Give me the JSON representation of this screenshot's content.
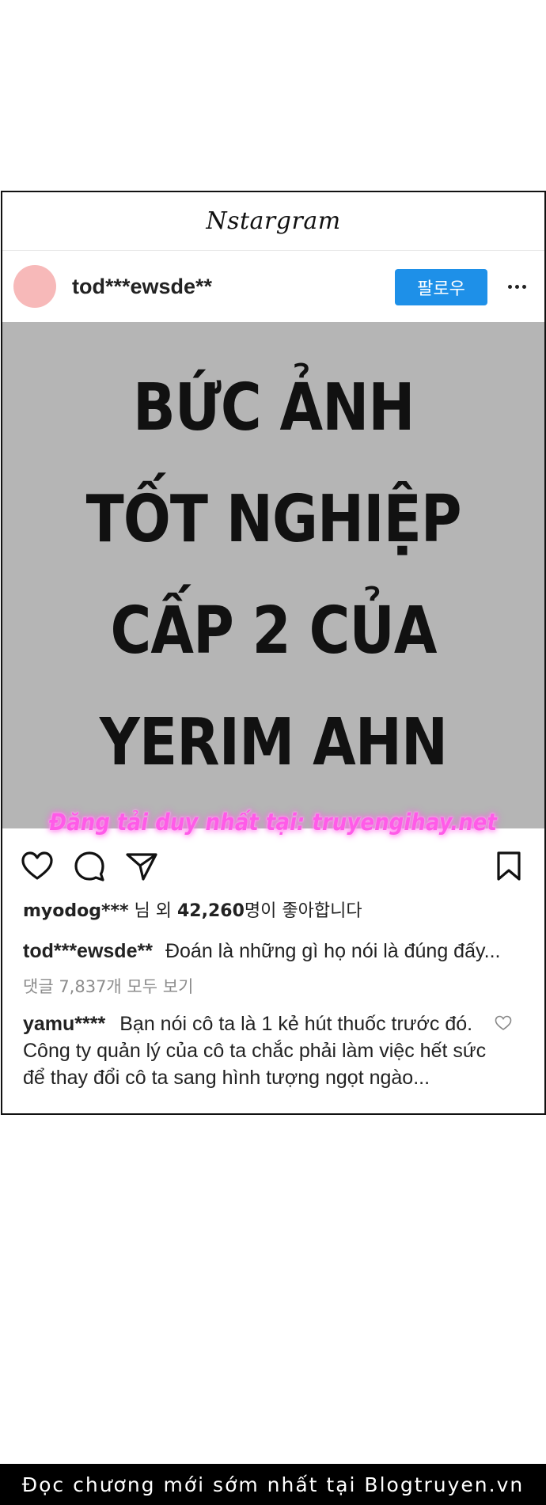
{
  "app": {
    "title": "Nstargram"
  },
  "post": {
    "username": "tod***ewsde**",
    "follow_label": "팔로우",
    "image_text": [
      "BỨC ẢNH",
      "TỐT NGHIỆP",
      "CẤP 2 CỦA",
      "YERIM AHN"
    ],
    "avatar_color": "#f7b9b9",
    "image_bg": "#b5b5b5"
  },
  "watermark": "Đăng tải duy nhất tại: truyengihay.net",
  "likes": {
    "user": "myodog***",
    "mid": "님 외 ",
    "count": "42,260",
    "suffix": "명이 좋아합니다"
  },
  "caption": {
    "user": "tod***ewsde**",
    "text": "Đoán là những gì họ nói là đúng đấy..."
  },
  "view_comments": "댓글 7,837개 모두 보기",
  "comment": {
    "user": "yamu****",
    "text": "Bạn nói cô ta là 1 kẻ hút thuốc trước đó. Công ty quản lý của cô ta chắc phải làm việc hết sức để thay đổi cô ta sang hình tượng ngọt ngào..."
  },
  "footer": "Đọc chương mới sớm nhất tại Blogtruyen.vn",
  "icons": [
    "heart-icon",
    "comment-icon",
    "share-icon",
    "bookmark-icon",
    "more-icon",
    "small-heart-icon"
  ],
  "colors": {
    "follow_button": "#1e90e8",
    "watermark": "#ff5be8",
    "footer_bg": "#000000"
  }
}
